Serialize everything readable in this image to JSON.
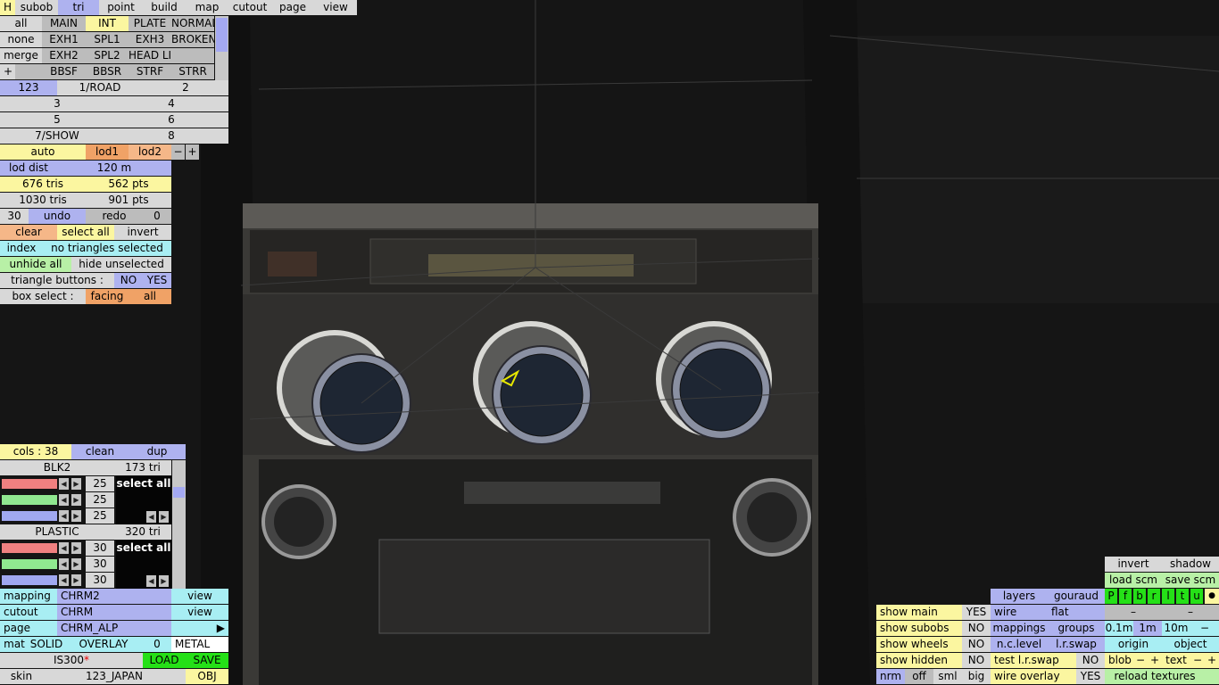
{
  "menu": {
    "h": "H",
    "tabs": [
      "subob",
      "tri",
      "point",
      "build",
      "map",
      "cutout",
      "page",
      "view"
    ]
  },
  "subobs": {
    "rows": [
      [
        "all",
        "MAIN",
        "INT",
        "PLATE",
        "NORMAL"
      ],
      [
        "none",
        "EXH1",
        "SPL1",
        "EXH3",
        "BROKEN"
      ],
      [
        "merge",
        "EXH2",
        "SPL2",
        "HEAD LI",
        ""
      ],
      [
        "+",
        "",
        "BBSF",
        "BBSR",
        "STRF",
        "STRR"
      ]
    ]
  },
  "groups": {
    "row1": [
      "123",
      "1/ROAD",
      "2"
    ],
    "row2": [
      "3",
      "4"
    ],
    "row3": [
      "5",
      "6"
    ],
    "row4": [
      "7/SHOW",
      "8"
    ]
  },
  "lod": {
    "auto": "auto",
    "lod1": "lod1",
    "lod2": "lod2",
    "minus": "−",
    "plus": "+",
    "dist_label": "lod dist",
    "dist_value": "120 m"
  },
  "stats": {
    "tris1": "676 tris",
    "pts1": "562 pts",
    "tris2": "1030 tris",
    "pts2": "901 pts"
  },
  "undo": {
    "count": "30",
    "undo": "undo",
    "redo": "redo",
    "redo_count": "0"
  },
  "select": {
    "clear": "clear",
    "select_all": "select all",
    "invert": "invert",
    "index": "index",
    "status": "no triangles selected",
    "unhide_all": "unhide all",
    "hide_unselected": "hide unselected",
    "tri_buttons": "triangle buttons :",
    "no": "NO",
    "yes": "YES",
    "box_select": "box select :",
    "facing": "facing",
    "all": "all"
  },
  "cols": {
    "label": "cols : 38",
    "clean": "clean",
    "dup": "dup"
  },
  "materials": [
    {
      "name": "BLK2",
      "tri": "173 tri",
      "values": [
        "25",
        "25",
        "25"
      ],
      "select_all": "select all"
    },
    {
      "name": "PLASTIC",
      "tri": "320 tri",
      "values": [
        "30",
        "30",
        "30"
      ],
      "select_all": "select all"
    }
  ],
  "mapping": {
    "mapping": "mapping",
    "mapping_val": "CHRM2",
    "view1": "view",
    "cutout": "cutout",
    "cutout_val": "CHRM",
    "view2": "view",
    "page": "page",
    "page_val": "CHRM_ALP",
    "arrow": "▶",
    "mat": "mat",
    "solid": "SOLID",
    "overlay": "OVERLAY",
    "zero": "0",
    "metal": "METAL",
    "file": "IS300",
    "star": "*",
    "load": "LOAD",
    "save": "SAVE",
    "skin": "skin",
    "skin_val": "123_JAPAN",
    "obj": "OBJ"
  },
  "display": {
    "show_main": "show main",
    "show_main_v": "YES",
    "show_subobs": "show subobs",
    "show_subobs_v": "NO",
    "show_wheels": "show wheels",
    "show_wheels_v": "NO",
    "show_hidden": "show hidden",
    "show_hidden_v": "NO",
    "nrm": "nrm",
    "off": "off",
    "sml": "sml",
    "big": "big",
    "layers": "layers",
    "gouraud": "gouraud",
    "wire": "wire",
    "flat": "flat",
    "mappings": "mappings",
    "groups": "groups",
    "nclevel": "n.c.level",
    "lrswap": "l.r.swap",
    "test_lrswap": "test l.r.swap",
    "test_lrswap_v": "NO",
    "wire_overlay": "wire overlay",
    "wire_overlay_v": "YES",
    "invert": "invert",
    "shadow": "shadow",
    "load_scm": "load scm",
    "save_scm": "save scm",
    "letters": [
      "P",
      "f",
      "b",
      "r",
      "l",
      "t",
      "u",
      "●"
    ],
    "dash": "–",
    "dist": [
      "0.1m",
      "1m",
      "10m",
      "−"
    ],
    "origin": "origin",
    "object": "object",
    "blob": "blob",
    "text": "text",
    "minus": "−",
    "plus": "+",
    "reload": "reload textures"
  },
  "colors": {
    "purple": "#aeb2ef",
    "yellow": "#fbf6a0",
    "orange": "#f5b788",
    "cyan": "#a8eef3",
    "green": "#b8f0a6",
    "brightgreen": "#25e017",
    "red_bar": "#f08080",
    "green_bar": "#90e890",
    "blue_bar": "#a0a8f0"
  }
}
